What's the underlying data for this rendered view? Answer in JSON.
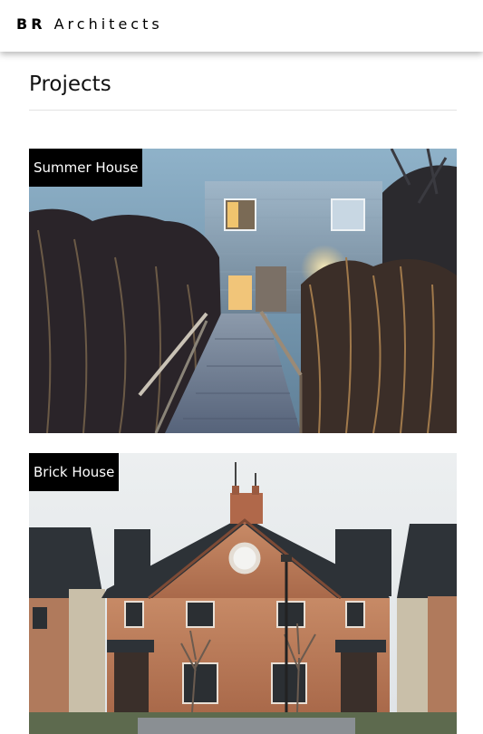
{
  "brand": {
    "strong": "BR",
    "rest": "Architects"
  },
  "section": {
    "title": "Projects"
  },
  "projects": [
    {
      "name": "Summer House"
    },
    {
      "name": "Brick House"
    }
  ]
}
